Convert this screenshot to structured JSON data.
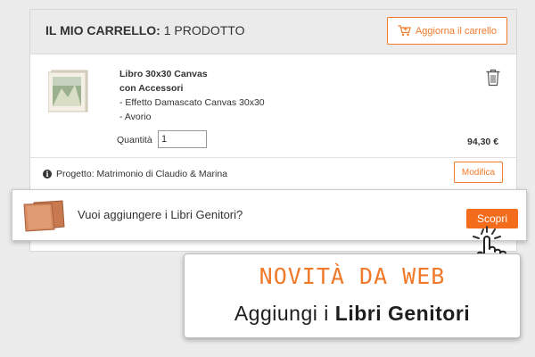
{
  "cart": {
    "title_bold": "IL MIO CARRELLO:",
    "title_count": " 1 PRODOTTO",
    "update_button": "Aggiorna il carrello"
  },
  "product": {
    "name_line1": "Libro 30x30 Canvas",
    "name_line2": "con Accessori",
    "option1": "- Effetto Damascato Canvas 30x30",
    "option2": "- Avorio",
    "quantity_label": "Quantità",
    "quantity_value": "1",
    "price": "94,30 €"
  },
  "project": {
    "label": "Progetto: Matrimonio di Claudio & Marina",
    "edit_button": "Modifica"
  },
  "promo": {
    "text": "Vuoi aggiungere i Libri Genitori?",
    "button": "Scopri"
  },
  "callout": {
    "headline": "NOVITÀ DA WEB",
    "tagline_prefix": "Aggiungi i ",
    "tagline_bold": "Libri Genitori"
  },
  "colors": {
    "accent": "#f07a2a",
    "cta": "#f26c1b",
    "header_bg": "#ebebeb"
  },
  "icons": [
    "cart-icon",
    "trash-icon",
    "info-icon",
    "pointer-hand-icon"
  ]
}
